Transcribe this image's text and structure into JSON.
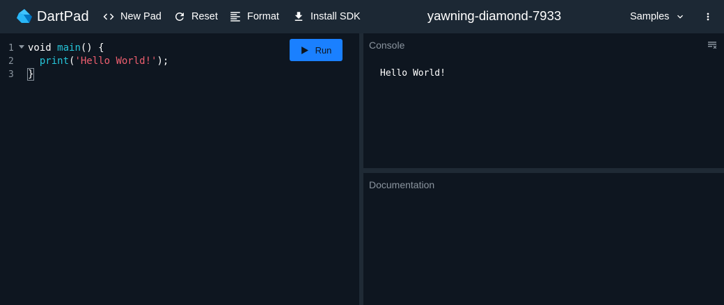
{
  "header": {
    "brand": "DartPad",
    "new_pad": "New Pad",
    "reset": "Reset",
    "format": "Format",
    "install_sdk": "Install SDK",
    "pad_title": "yawning-diamond-7933",
    "samples": "Samples"
  },
  "editor": {
    "run_label": "Run",
    "line_numbers": [
      "1",
      "2",
      "3"
    ],
    "line1": {
      "kw": "void ",
      "fn": "main",
      "rest": "() {"
    },
    "line2": {
      "indent": "  ",
      "fn": "print",
      "open": "(",
      "str": "'Hello World!'",
      "close": ");"
    },
    "line3": {
      "brace": "}"
    }
  },
  "console": {
    "label": "Console",
    "output": "Hello World!"
  },
  "documentation": {
    "label": "Documentation"
  },
  "colors": {
    "header_bg": "#1c2834",
    "editor_bg": "#0e1620",
    "accent_blue": "#1a80ff",
    "function_cyan": "#26c6da",
    "string_red": "#ef5f6f"
  }
}
